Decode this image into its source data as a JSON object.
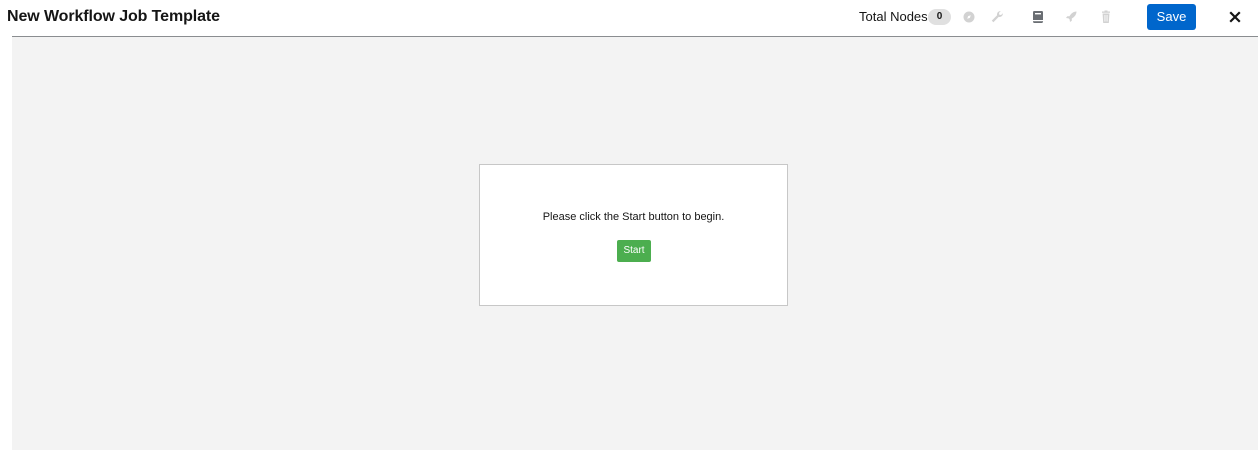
{
  "header": {
    "title": "New Workflow Job Template",
    "total_nodes_label": "Total Nodes",
    "total_nodes_count": "0",
    "save_label": "Save"
  },
  "toolbar": {
    "icons": [
      "compass-icon",
      "wrench-icon",
      "book-icon",
      "rocket-icon",
      "trash-icon",
      "close-icon"
    ]
  },
  "canvas": {
    "message": "Please click the Start button to begin.",
    "start_label": "Start"
  },
  "colors": {
    "save_button": "#0066cc",
    "start_button": "#4cae4f",
    "canvas_background": "#f3f3f3",
    "disabled_icon": "#d2d2d2",
    "active_icon": "#6a6e73"
  }
}
